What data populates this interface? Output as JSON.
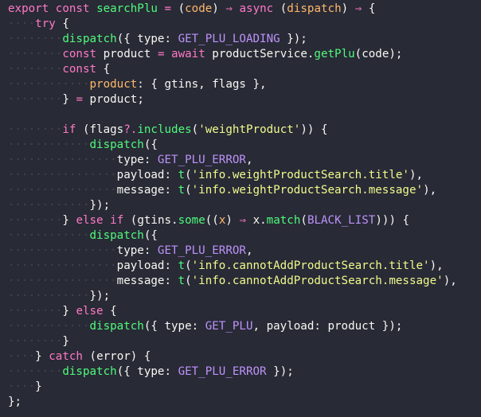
{
  "editor": {
    "theme": {
      "background": "#282a36",
      "foreground": "#f8f8f2",
      "keyword": "#ff79c6",
      "function": "#50fa7b",
      "parameter": "#ffb86c",
      "string": "#f1fa8c",
      "constant": "#bd93f9",
      "whitespace_marker": "#424450"
    },
    "lines": [
      [
        [
          "kw",
          "export"
        ],
        [
          "pl",
          " "
        ],
        [
          "kw",
          "const"
        ],
        [
          "pl",
          " "
        ],
        [
          "fn",
          "searchPlu"
        ],
        [
          "pl",
          " "
        ],
        [
          "op",
          "="
        ],
        [
          "pl",
          " ("
        ],
        [
          "pr",
          "code"
        ],
        [
          "pl",
          ") "
        ],
        [
          "op",
          "⇒"
        ],
        [
          "pl",
          " "
        ],
        [
          "kw",
          "async"
        ],
        [
          "pl",
          " ("
        ],
        [
          "pr",
          "dispatch"
        ],
        [
          "pl",
          ") "
        ],
        [
          "op",
          "⇒"
        ],
        [
          "pl",
          " {"
        ]
      ],
      [
        [
          "ws",
          "····"
        ],
        [
          "kw",
          "try"
        ],
        [
          "pl",
          " {"
        ]
      ],
      [
        [
          "ws",
          "········"
        ],
        [
          "fn",
          "dispatch"
        ],
        [
          "pl",
          "({ type: "
        ],
        [
          "co",
          "GET_PLU_LOADING"
        ],
        [
          "pl",
          " });"
        ]
      ],
      [
        [
          "ws",
          "········"
        ],
        [
          "kw",
          "const"
        ],
        [
          "pl",
          " product "
        ],
        [
          "op",
          "="
        ],
        [
          "pl",
          " "
        ],
        [
          "kw",
          "await"
        ],
        [
          "pl",
          " productService."
        ],
        [
          "fn",
          "getPlu"
        ],
        [
          "pl",
          "(code);"
        ]
      ],
      [
        [
          "ws",
          "········"
        ],
        [
          "kw",
          "const"
        ],
        [
          "pl",
          " {"
        ]
      ],
      [
        [
          "ws",
          "············"
        ],
        [
          "pr",
          "product"
        ],
        [
          "pl",
          ": { gtins, flags },"
        ]
      ],
      [
        [
          "ws",
          "········"
        ],
        [
          "pl",
          "} "
        ],
        [
          "op",
          "="
        ],
        [
          "pl",
          " product;"
        ]
      ],
      [],
      [
        [
          "ws",
          "········"
        ],
        [
          "kw",
          "if"
        ],
        [
          "pl",
          " (flags"
        ],
        [
          "op",
          "?."
        ],
        [
          "fn",
          "includes"
        ],
        [
          "pl",
          "("
        ],
        [
          "str",
          "'weightProduct'"
        ],
        [
          "pl",
          ")) {"
        ]
      ],
      [
        [
          "ws",
          "············"
        ],
        [
          "fn",
          "dispatch"
        ],
        [
          "pl",
          "({"
        ]
      ],
      [
        [
          "ws",
          "················"
        ],
        [
          "pl",
          "type: "
        ],
        [
          "co",
          "GET_PLU_ERROR"
        ],
        [
          "pl",
          ","
        ]
      ],
      [
        [
          "ws",
          "················"
        ],
        [
          "pl",
          "payload: "
        ],
        [
          "fn",
          "t"
        ],
        [
          "pl",
          "("
        ],
        [
          "str",
          "'info.weightProductSearch.title'"
        ],
        [
          "pl",
          "),"
        ]
      ],
      [
        [
          "ws",
          "················"
        ],
        [
          "pl",
          "message: "
        ],
        [
          "fn",
          "t"
        ],
        [
          "pl",
          "("
        ],
        [
          "str",
          "'info.weightProductSearch.message'"
        ],
        [
          "pl",
          "),"
        ]
      ],
      [
        [
          "ws",
          "············"
        ],
        [
          "pl",
          "});"
        ]
      ],
      [
        [
          "ws",
          "········"
        ],
        [
          "pl",
          "} "
        ],
        [
          "kw",
          "else"
        ],
        [
          "pl",
          " "
        ],
        [
          "kw",
          "if"
        ],
        [
          "pl",
          " (gtins."
        ],
        [
          "fn",
          "some"
        ],
        [
          "pl",
          "(("
        ],
        [
          "pr",
          "x"
        ],
        [
          "pl",
          ") "
        ],
        [
          "op",
          "⇒"
        ],
        [
          "pl",
          " x."
        ],
        [
          "fn",
          "match"
        ],
        [
          "pl",
          "("
        ],
        [
          "co",
          "BLACK_LIST"
        ],
        [
          "pl",
          "))) {"
        ]
      ],
      [
        [
          "ws",
          "············"
        ],
        [
          "fn",
          "dispatch"
        ],
        [
          "pl",
          "({"
        ]
      ],
      [
        [
          "ws",
          "················"
        ],
        [
          "pl",
          "type: "
        ],
        [
          "co",
          "GET_PLU_ERROR"
        ],
        [
          "pl",
          ","
        ]
      ],
      [
        [
          "ws",
          "················"
        ],
        [
          "pl",
          "payload: "
        ],
        [
          "fn",
          "t"
        ],
        [
          "pl",
          "("
        ],
        [
          "str",
          "'info.cannotAddProductSearch.title'"
        ],
        [
          "pl",
          "),"
        ]
      ],
      [
        [
          "ws",
          "················"
        ],
        [
          "pl",
          "message: "
        ],
        [
          "fn",
          "t"
        ],
        [
          "pl",
          "("
        ],
        [
          "str",
          "'info.cannotAddProductSearch.message'"
        ],
        [
          "pl",
          "),"
        ]
      ],
      [
        [
          "ws",
          "············"
        ],
        [
          "pl",
          "});"
        ]
      ],
      [
        [
          "ws",
          "········"
        ],
        [
          "pl",
          "} "
        ],
        [
          "kw",
          "else"
        ],
        [
          "pl",
          " {"
        ]
      ],
      [
        [
          "ws",
          "············"
        ],
        [
          "fn",
          "dispatch"
        ],
        [
          "pl",
          "({ type: "
        ],
        [
          "co",
          "GET_PLU"
        ],
        [
          "pl",
          ", payload: product });"
        ]
      ],
      [
        [
          "ws",
          "········"
        ],
        [
          "pl",
          "}"
        ]
      ],
      [
        [
          "ws",
          "····"
        ],
        [
          "pl",
          "} "
        ],
        [
          "kw",
          "catch"
        ],
        [
          "pl",
          " (error) {"
        ]
      ],
      [
        [
          "ws",
          "········"
        ],
        [
          "fn",
          "dispatch"
        ],
        [
          "pl",
          "({ type: "
        ],
        [
          "co",
          "GET_PLU_ERROR"
        ],
        [
          "pl",
          " });"
        ]
      ],
      [
        [
          "ws",
          "····"
        ],
        [
          "pl",
          "}"
        ]
      ],
      [
        [
          "pl",
          "};"
        ]
      ]
    ]
  }
}
